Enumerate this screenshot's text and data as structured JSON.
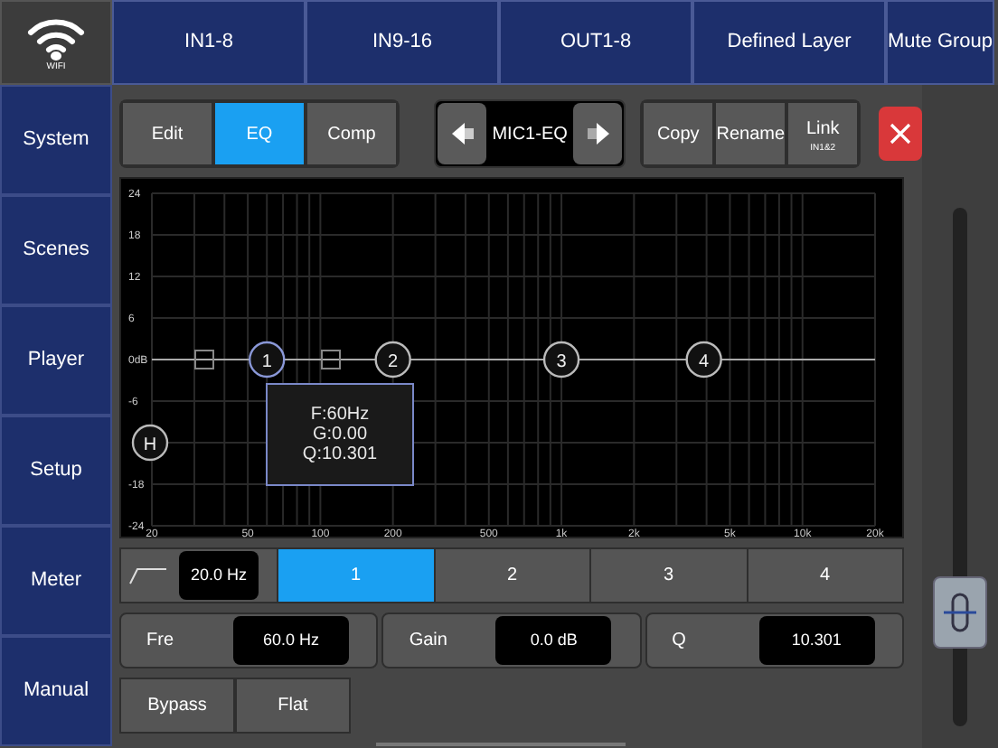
{
  "wifi": {
    "label": "WIFI"
  },
  "top_tabs": [
    {
      "label": "IN1-8",
      "selected": false
    },
    {
      "label": "IN9-16",
      "selected": false
    },
    {
      "label": "OUT1-8",
      "selected": false
    },
    {
      "label": "Defined Layer",
      "selected": false
    },
    {
      "label": "Mute Group",
      "selected": false
    }
  ],
  "sidebar": {
    "items": [
      {
        "label": "System"
      },
      {
        "label": "Scenes"
      },
      {
        "label": "Player"
      },
      {
        "label": "Setup"
      },
      {
        "label": "Meter"
      },
      {
        "label": "Manual"
      }
    ]
  },
  "mode_tabs": [
    {
      "label": "Edit",
      "selected": false
    },
    {
      "label": "EQ",
      "selected": true
    },
    {
      "label": "Comp",
      "selected": false
    }
  ],
  "channel": {
    "name": "MIC1-EQ"
  },
  "actions": [
    {
      "label": "Copy"
    },
    {
      "label": "Rename"
    },
    {
      "label": "Link",
      "sublabel": "IN1&2"
    }
  ],
  "graph": {
    "y_ticks": [
      "24",
      "18",
      "12",
      "6",
      "0dB",
      "-6",
      "-18",
      "-24"
    ],
    "x_ticks": [
      "20",
      "50",
      "100",
      "200",
      "500",
      "1k",
      "2k",
      "5k",
      "10k",
      "20k"
    ],
    "nodes": [
      {
        "label": "1",
        "selected": true
      },
      {
        "label": "2",
        "selected": false
      },
      {
        "label": "3",
        "selected": false
      },
      {
        "label": "4",
        "selected": false
      }
    ],
    "high_pass_node": {
      "label": "H"
    },
    "tooltip": [
      "F:60Hz",
      "G:0.00",
      "Q:10.301"
    ]
  },
  "filter": {
    "value": "20.0 Hz"
  },
  "bands": [
    {
      "label": "1",
      "selected": true
    },
    {
      "label": "2",
      "selected": false
    },
    {
      "label": "3",
      "selected": false
    },
    {
      "label": "4",
      "selected": false
    }
  ],
  "params": [
    {
      "label": "Fre",
      "value": "60.0 Hz"
    },
    {
      "label": "Gain",
      "value": "0.0 dB"
    },
    {
      "label": "Q",
      "value": "10.301"
    }
  ],
  "buttons": [
    "Bypass",
    "Flat"
  ],
  "fader": {
    "level": 0.22
  }
}
